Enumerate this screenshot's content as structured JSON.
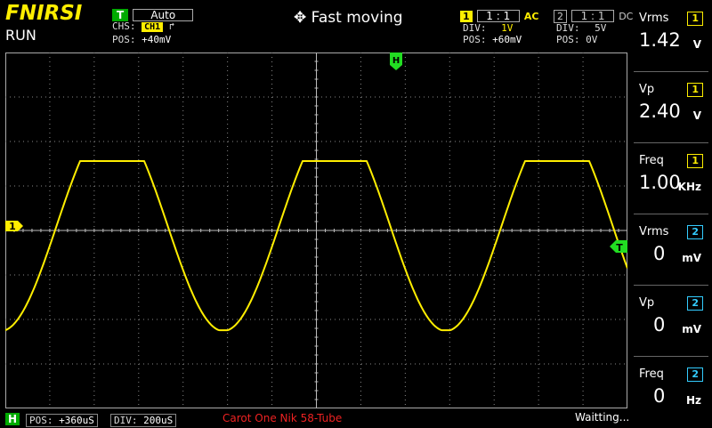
{
  "header": {
    "logo": "FNIRSI",
    "run_state": "RUN",
    "trigger": {
      "badge": "T",
      "mode": "Auto",
      "chs_label": "CHS:",
      "chs_value": "CH1",
      "edge_symbol": "⼊",
      "pos_label": "POS:",
      "pos_value": "+40mV"
    },
    "title": "Fast moving",
    "ch1": {
      "num": "1",
      "probe": "1 : 1",
      "coupling": "AC",
      "div_label": "DIV:",
      "div_value": "1V",
      "pos_label": "POS:",
      "pos_value": "+60mV"
    },
    "ch2": {
      "num": "2",
      "probe": "1 : 1",
      "coupling": "DC",
      "div_label": "DIV:",
      "div_value": "5V",
      "pos_label": "POS:",
      "pos_value": "0V"
    }
  },
  "screen": {
    "markers": {
      "h_marker": "H",
      "ch1_marker": "1",
      "trigger_marker": "T"
    },
    "colors": {
      "ch1": "#ffee00",
      "grid": "#888888",
      "marker": "#22dd22"
    }
  },
  "measurements": [
    {
      "label": "Vrms",
      "channel": "1",
      "value": "1.42",
      "unit": "V"
    },
    {
      "label": "Vp",
      "channel": "1",
      "value": "2.40",
      "unit": "V"
    },
    {
      "label": "Freq",
      "channel": "1",
      "value": "1.00",
      "unit": "KHz"
    },
    {
      "label": "Vrms",
      "channel": "2",
      "value": "0",
      "unit": "mV"
    },
    {
      "label": "Vp",
      "channel": "2",
      "value": "0",
      "unit": "mV"
    },
    {
      "label": "Freq",
      "channel": "2",
      "value": "0",
      "unit": "Hz"
    }
  ],
  "bottom": {
    "h_badge": "H",
    "pos_label": "POS:",
    "pos_value": "+360uS",
    "div_label": "DIV:",
    "div_value": "200uS",
    "device_caption": "Carot One Nik 58-Tube",
    "status": "Waitting..."
  }
}
